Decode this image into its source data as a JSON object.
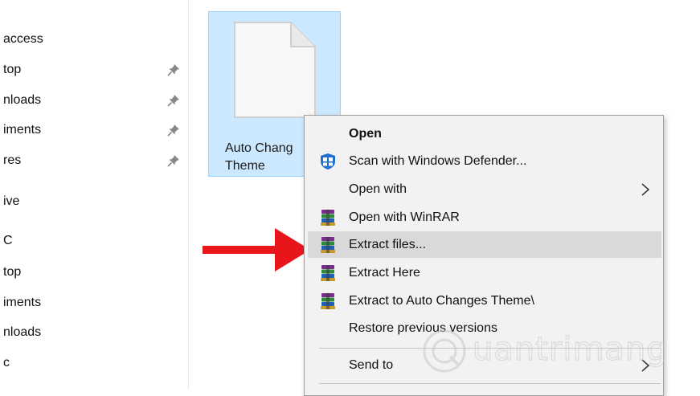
{
  "nav": {
    "items": [
      {
        "label": "access",
        "pinned": false
      },
      {
        "label": "top",
        "pinned": true
      },
      {
        "label": "nloads",
        "pinned": true
      },
      {
        "label": "iments",
        "pinned": true
      },
      {
        "label": "res",
        "pinned": true
      },
      {
        "label": "ive",
        "pinned": false
      },
      {
        "label": "C",
        "pinned": false
      },
      {
        "label": "top",
        "pinned": false
      },
      {
        "label": "iments",
        "pinned": false
      },
      {
        "label": "nloads",
        "pinned": false
      },
      {
        "label": "c",
        "pinned": false
      }
    ]
  },
  "file": {
    "name_line1": "Auto Chang",
    "name_line2": "Theme",
    "icon": "document-icon"
  },
  "menu": {
    "items": [
      {
        "label": "Open",
        "icon": "",
        "bold": true
      },
      {
        "label": "Scan with Windows Defender...",
        "icon": "windows-defender-icon"
      },
      {
        "label": "Open with",
        "icon": "",
        "submenu": true
      },
      {
        "label": "Open with WinRAR",
        "icon": "winrar-icon"
      },
      {
        "label": "Extract files...",
        "icon": "winrar-icon",
        "highlighted": true
      },
      {
        "label": "Extract Here",
        "icon": "winrar-icon"
      },
      {
        "label": "Extract to Auto Changes Theme\\",
        "icon": "winrar-icon"
      },
      {
        "label": "Restore previous versions",
        "icon": ""
      },
      {
        "label": "Send to",
        "icon": "",
        "submenu": true
      }
    ]
  },
  "watermark": {
    "text": "uantrimang"
  },
  "colors": {
    "selection_bg": "#cce8ff",
    "menu_bg": "#f2f2f2",
    "menu_highlight": "#d9d9d9",
    "arrow_red": "#e8161b"
  }
}
